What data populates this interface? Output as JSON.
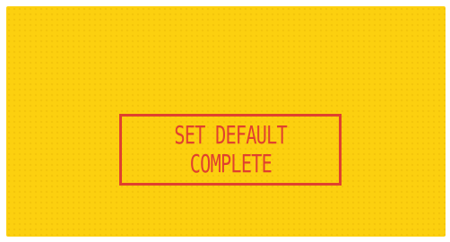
{
  "screen": {
    "background_color": "#fcd00f",
    "accent_color": "#e0412e",
    "message": {
      "line1": "SET DEFAULT",
      "line2": "COMPLETE"
    }
  }
}
